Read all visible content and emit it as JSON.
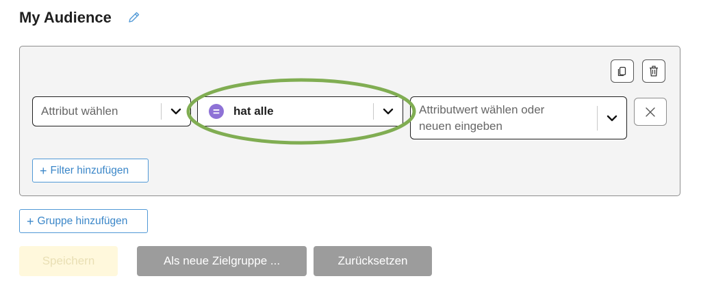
{
  "page": {
    "title": "My Audience"
  },
  "group": {
    "filter": {
      "attribute_placeholder": "Attribut wählen",
      "operator": {
        "badge": "=",
        "label": "hat alle"
      },
      "value_placeholder_line1": "Attributwert wählen oder",
      "value_placeholder_line2": "neuen eingeben"
    },
    "add_filter_label": "Filter hinzufügen"
  },
  "add_group_label": "Gruppe hinzufügen",
  "actions": {
    "save_label": "Speichern",
    "save_as_new_label": "Als neue Zielgruppe ...",
    "reset_label": "Zurücksetzen"
  },
  "icons": [
    "edit-pencil-icon",
    "copy-icon",
    "trash-icon",
    "chevron-down-icon",
    "close-icon",
    "plus-icon"
  ],
  "colors": {
    "accent": "#4f98d6",
    "operator_badge": "#8e72d6",
    "highlight": "#80ad52",
    "save_disabled_bg": "#fff8dc",
    "secondary_btn_bg": "#9c9c9c"
  }
}
